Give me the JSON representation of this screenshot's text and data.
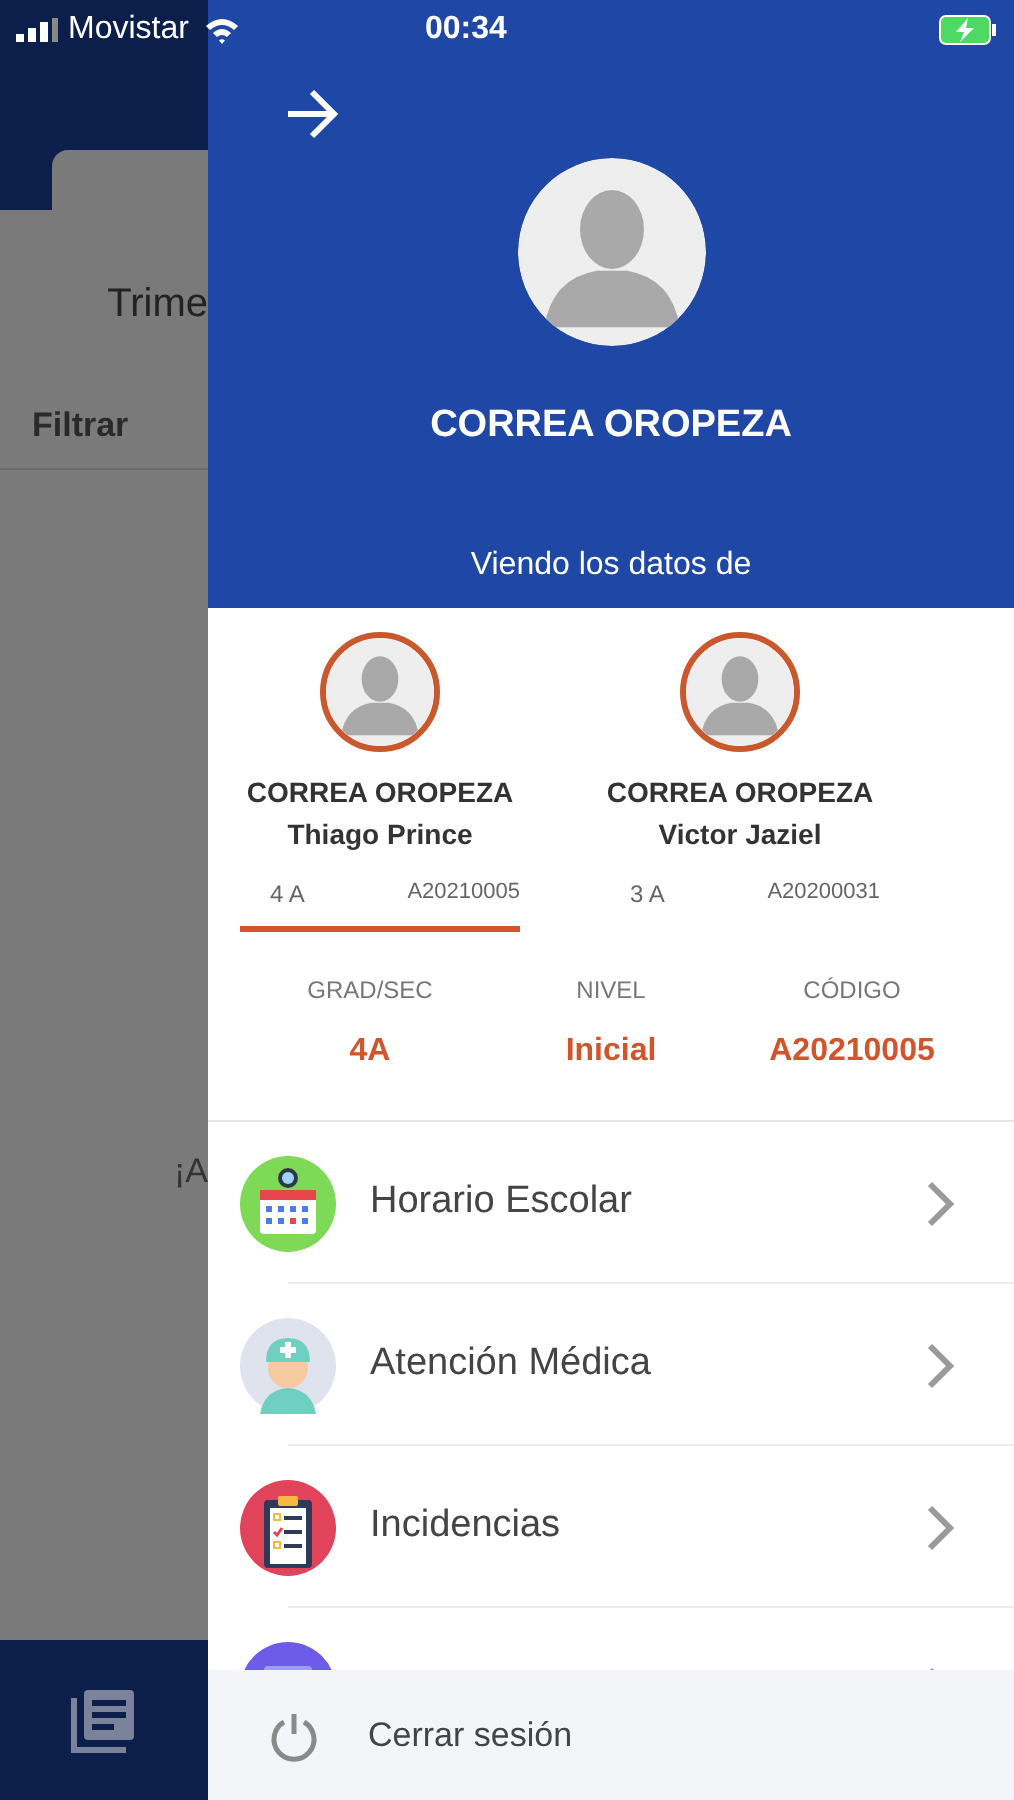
{
  "status_bar": {
    "carrier": "Movistar",
    "time": "00:34",
    "charging": true
  },
  "background": {
    "tab_label": "Trime",
    "filter_label": "Filtrar",
    "message": "¡A"
  },
  "drawer": {
    "user_name": "CORREA OROPEZA",
    "viewing_label": "Viendo los datos de",
    "students": [
      {
        "surname": "CORREA OROPEZA",
        "first_name": "Thiago Prince",
        "grade": "4 A",
        "code": "A20210005",
        "selected": true
      },
      {
        "surname": "CORREA OROPEZA",
        "first_name": "Victor Jaziel",
        "grade": "3 A",
        "code": "A20200031",
        "selected": false
      }
    ],
    "details": [
      {
        "label": "GRAD/SEC",
        "value": "4A"
      },
      {
        "label": "NIVEL",
        "value": "Inicial"
      },
      {
        "label": "CÓDIGO",
        "value": "A20210005"
      }
    ],
    "menu": [
      {
        "kind": "schedule",
        "label": "Horario Escolar"
      },
      {
        "kind": "medical",
        "label": "Atención Médica"
      },
      {
        "kind": "incidents",
        "label": "Incidencias"
      },
      {
        "kind": "other"
      }
    ],
    "logout": "Cerrar sesión"
  }
}
